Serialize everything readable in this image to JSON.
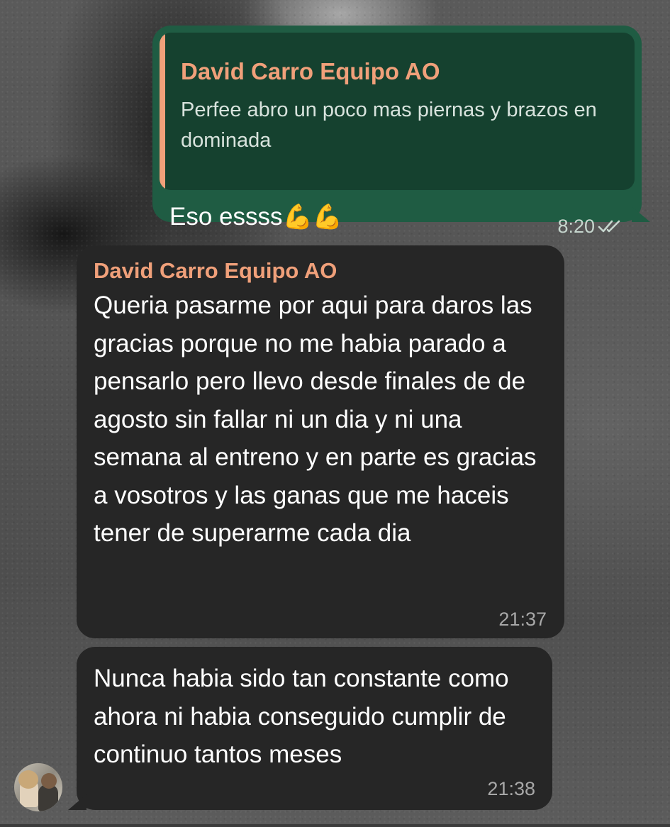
{
  "outgoing": {
    "quote": {
      "author": "David Carro Equipo AO",
      "text": "Perfee abro un poco mas piernas y brazos en dominada"
    },
    "text": "Eso essss",
    "emoji": "💪💪",
    "time": "8:20",
    "status_icon": "double-check-icon"
  },
  "incoming": [
    {
      "author": "David Carro Equipo AO",
      "text": "Queria pasarme por aqui para daros las gracias porque no me habia parado a pensarlo pero llevo desde finales de de agosto sin fallar ni un dia y ni una semana al entreno y en parte es gracias a vosotros y las ganas que me haceis tener de superarme cada dia",
      "time": "21:37"
    },
    {
      "text": "Nunca habia sido tan constante como ahora ni habia conseguido cumplir de continuo tantos meses",
      "time": "21:38"
    }
  ],
  "colors": {
    "outgoing_bubble": "#1f5c43",
    "quote_background": "#15412f",
    "incoming_bubble": "#262626",
    "author_name": "#f0a07a"
  }
}
